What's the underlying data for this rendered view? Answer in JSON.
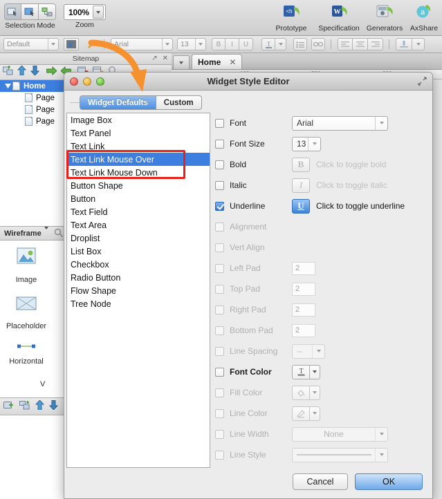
{
  "app": {
    "toolbar": {
      "selection_mode_label": "Selection Mode",
      "zoom_label": "Zoom",
      "zoom_value": "100%",
      "actions": [
        {
          "label": "Prototype",
          "icon": "prototype-icon"
        },
        {
          "label": "Specification",
          "icon": "specification-icon"
        },
        {
          "label": "Generators",
          "icon": "generators-icon"
        },
        {
          "label": "AxShare",
          "icon": "axshare-icon"
        }
      ]
    },
    "format_bar": {
      "style_value": "Default",
      "font_value": "Arial",
      "size_value": "13",
      "bold_label": "B",
      "italic_label": "I",
      "underline_label": "U"
    }
  },
  "sitemap": {
    "title": "Sitemap",
    "expand_icon": "expand-icon",
    "close_icon": "close-icon",
    "tree": [
      {
        "label": "Home",
        "selected": true
      },
      {
        "label": "Page",
        "selected": false
      },
      {
        "label": "Page",
        "selected": false
      },
      {
        "label": "Page",
        "selected": false
      }
    ]
  },
  "wireframe": {
    "title": "Wireframe",
    "search_icon": "search-icon",
    "items": [
      {
        "label": "Image",
        "icon": "image-icon"
      },
      {
        "label": "Placeholder",
        "icon": "placeholder-icon"
      },
      {
        "label": "Horizontal",
        "icon": "horizontal-line-icon"
      },
      {
        "label": "V",
        "icon": "vertical-line-icon"
      }
    ]
  },
  "canvas": {
    "tab_menu_icon": "chevron-down-icon",
    "tabs": [
      {
        "label": "Home",
        "close_icon": "close-icon",
        "active": true
      }
    ],
    "ruler_ticks": [
      "100",
      "200",
      "300"
    ]
  },
  "dialog": {
    "title": "Widget Style Editor",
    "resize_icon": "resize-icon",
    "traffic_lights": [
      "close-button",
      "minimize-button",
      "zoom-button"
    ],
    "tabs": [
      {
        "label": "Widget Defaults",
        "active": true
      },
      {
        "label": "Custom",
        "active": false
      }
    ],
    "widget_list": [
      {
        "label": "Image Box",
        "selected": false
      },
      {
        "label": "Text Panel",
        "selected": false
      },
      {
        "label": "Text Link",
        "selected": false
      },
      {
        "label": "Text Link Mouse Over",
        "selected": true
      },
      {
        "label": "Text Link Mouse Down",
        "selected": false
      },
      {
        "label": "Button Shape",
        "selected": false
      },
      {
        "label": "Button",
        "selected": false
      },
      {
        "label": "Text Field",
        "selected": false
      },
      {
        "label": "Text Area",
        "selected": false
      },
      {
        "label": "Droplist",
        "selected": false
      },
      {
        "label": "List Box",
        "selected": false
      },
      {
        "label": "Checkbox",
        "selected": false
      },
      {
        "label": "Radio Button",
        "selected": false
      },
      {
        "label": "Flow Shape",
        "selected": false
      },
      {
        "label": "Tree Node",
        "selected": false
      }
    ],
    "properties": {
      "font": {
        "label": "Font",
        "checked": false,
        "enabled": true,
        "value": "Arial"
      },
      "font_size": {
        "label": "Font Size",
        "checked": false,
        "enabled": true,
        "value": "13"
      },
      "bold": {
        "label": "Bold",
        "checked": false,
        "enabled": false,
        "toggle_glyph": "B",
        "hint": "Click to toggle bold"
      },
      "italic": {
        "label": "Italic",
        "checked": false,
        "enabled": false,
        "toggle_glyph": "I",
        "hint": "Click to toggle italic"
      },
      "underline": {
        "label": "Underline",
        "checked": true,
        "enabled": true,
        "toggle_glyph": "U",
        "hint": "Click to toggle underline"
      },
      "alignment": {
        "label": "Alignment",
        "checked": false,
        "enabled": false
      },
      "vert_align": {
        "label": "Vert Align",
        "checked": false,
        "enabled": false
      },
      "left_pad": {
        "label": "Left Pad",
        "checked": false,
        "enabled": false,
        "value": "2"
      },
      "top_pad": {
        "label": "Top Pad",
        "checked": false,
        "enabled": false,
        "value": "2"
      },
      "right_pad": {
        "label": "Right Pad",
        "checked": false,
        "enabled": false,
        "value": "2"
      },
      "bottom_pad": {
        "label": "Bottom Pad",
        "checked": false,
        "enabled": false,
        "value": "2"
      },
      "line_spacing": {
        "label": "Line Spacing",
        "checked": false,
        "enabled": false,
        "value": "--"
      },
      "font_color": {
        "label": "Font Color",
        "checked": false,
        "enabled": true,
        "glyph": "T"
      },
      "fill_color": {
        "label": "Fill Color",
        "checked": false,
        "enabled": false,
        "glyph": "fill-bucket-icon"
      },
      "line_color": {
        "label": "Line Color",
        "checked": false,
        "enabled": false,
        "glyph": "pen-icon"
      },
      "line_width": {
        "label": "Line Width",
        "checked": false,
        "enabled": false,
        "value": "None"
      },
      "line_style": {
        "label": "Line Style",
        "checked": false,
        "enabled": false,
        "value": ""
      }
    },
    "footer": {
      "cancel_label": "Cancel",
      "ok_label": "OK"
    }
  },
  "annotations": {
    "highlight_color": "#e8201a",
    "arrow_color": "#f5912e",
    "selection_color": "#3d7fe0"
  }
}
